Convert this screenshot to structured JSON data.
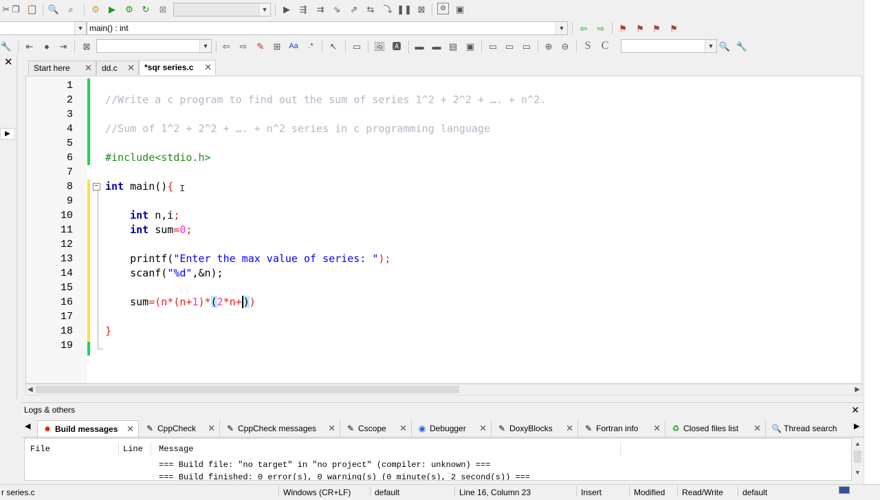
{
  "toolbar": {
    "function_scope": "main() : int",
    "main_combo": "",
    "search_combo": ""
  },
  "tabs": [
    {
      "label": "Start here"
    },
    {
      "label": "dd.c"
    },
    {
      "label": "*sqr series.c"
    }
  ],
  "editor": {
    "line_numbers": [
      "1",
      "2",
      "3",
      "4",
      "5",
      "6",
      "7",
      "8",
      "9",
      "10",
      "11",
      "12",
      "13",
      "14",
      "15",
      "16",
      "17",
      "18",
      "19"
    ],
    "comment1": "//Write a c program to find out the sum of series 1^2 + 2^2 + …. + n^2.",
    "comment2": "//Sum of 1^2 + 2^2 + …. + n^2 series in c programming language",
    "include": "#include<stdio.h>",
    "main_kw": "int",
    "main_sig": " main()",
    "main_brace": "{",
    "decl1_kw": "int",
    "decl1_rest": " n,i",
    "decl2_kw": "int",
    "decl2_rest": " sum",
    "decl2_eq": "=",
    "decl2_val": "0",
    "printf_fn": "printf(",
    "printf_str": "\"Enter the max value of series: \"",
    "printf_end": ");",
    "scanf_fn": "scanf(",
    "scanf_str": "\"%d\"",
    "scanf_rest": ",&n);",
    "sum_lhs": "sum",
    "sum_expr_a": "(n",
    "sum_mul1": "*",
    "sum_expr_b": "(n",
    "sum_plus1": "+",
    "sum_one": "1",
    "sum_close1": ")",
    "sum_mul2": "*",
    "sum_paren_open": "(",
    "sum_two": "2",
    "sum_mul3": "*",
    "sum_n": "n",
    "sum_plus2": "+",
    "sum_close_cursor": ")",
    "sum_close_final": ")",
    "close_brace": "}"
  },
  "logs": {
    "panel_title": "Logs & others",
    "tabs": [
      {
        "label": "Build messages",
        "icon": "build-icon"
      },
      {
        "label": "CppCheck",
        "icon": "pencil-icon"
      },
      {
        "label": "CppCheck messages",
        "icon": "pencil-icon"
      },
      {
        "label": "Cscope",
        "icon": "pencil-icon"
      },
      {
        "label": "Debugger",
        "icon": "debugger-icon"
      },
      {
        "label": "DoxyBlocks",
        "icon": "pencil-icon"
      },
      {
        "label": "Fortran info",
        "icon": "pencil-icon"
      },
      {
        "label": "Closed files list",
        "icon": "recycle-icon"
      },
      {
        "label": "Thread search",
        "icon": "search-icon"
      }
    ],
    "columns": [
      "File",
      "Line",
      "Message"
    ],
    "messages": [
      "=== Build file: \"no target\" in \"no project\" (compiler: unknown) ===",
      "=== Build finished: 0 error(s), 0 warning(s) (0 minute(s), 2 second(s)) ==="
    ]
  },
  "status": {
    "file": "r series.c",
    "eol": "Windows (CR+LF)",
    "encoding": "default",
    "position": "Line 16, Column 23",
    "mode": "Insert",
    "modified": "Modified",
    "access": "Read/Write",
    "lang": "default"
  }
}
